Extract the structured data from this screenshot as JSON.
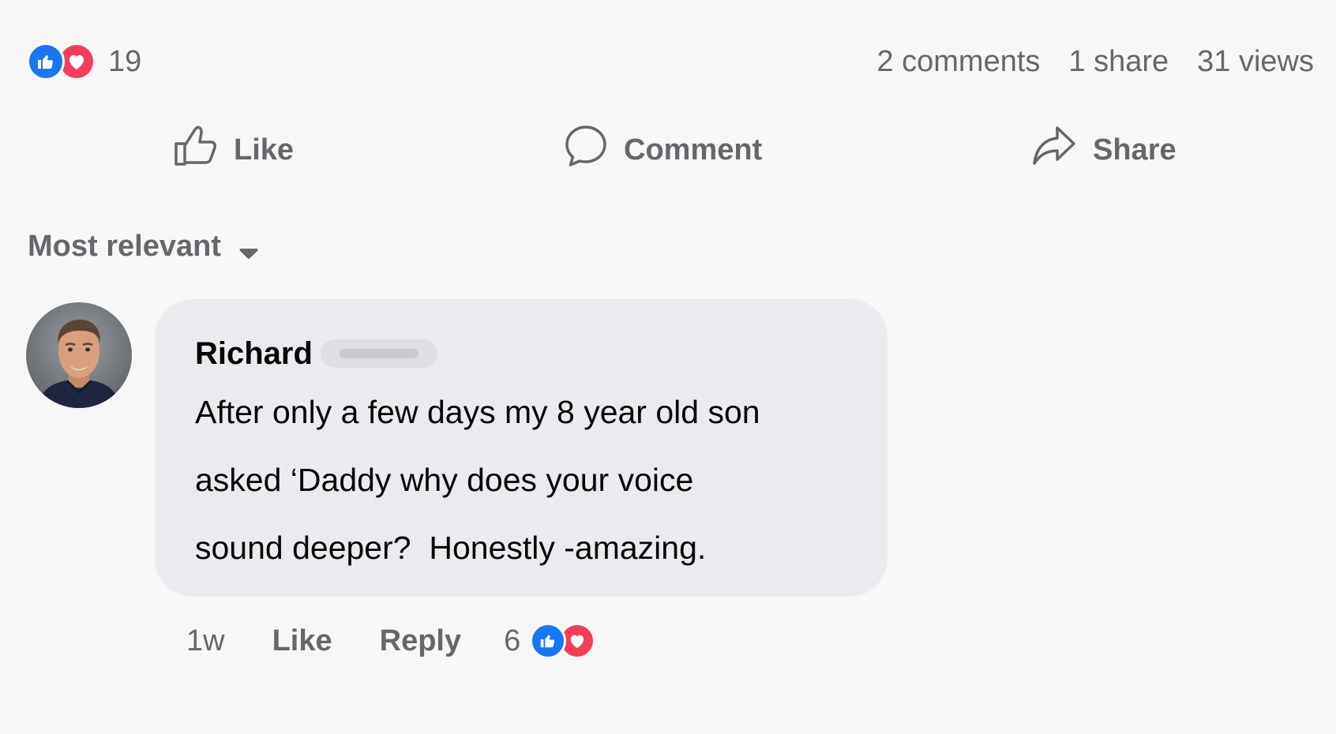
{
  "post_stats": {
    "reaction_count": "19",
    "comments": "2 comments",
    "shares": "1 share",
    "views": "31 views"
  },
  "actions": {
    "like": "Like",
    "comment": "Comment",
    "share": "Share"
  },
  "sort": {
    "label": "Most relevant"
  },
  "comment": {
    "author": "Richard",
    "lines": [
      "After only a few days my 8 year old son",
      "asked ‘Daddy why does your voice",
      "sound deeper?  Honestly -amazing."
    ],
    "time": "1w",
    "like_label": "Like",
    "reply_label": "Reply",
    "reaction_count": "6"
  },
  "colors": {
    "like_blue": "#1877f2",
    "love_red": "#f33e58",
    "bubble": "#ebebef",
    "muted_text": "#65676b",
    "text": "#050505"
  },
  "icons": {
    "like": "thumbs-up-icon",
    "love": "heart-icon",
    "comment": "speech-bubble-icon",
    "share": "share-arrow-icon",
    "sort": "caret-down-icon"
  }
}
